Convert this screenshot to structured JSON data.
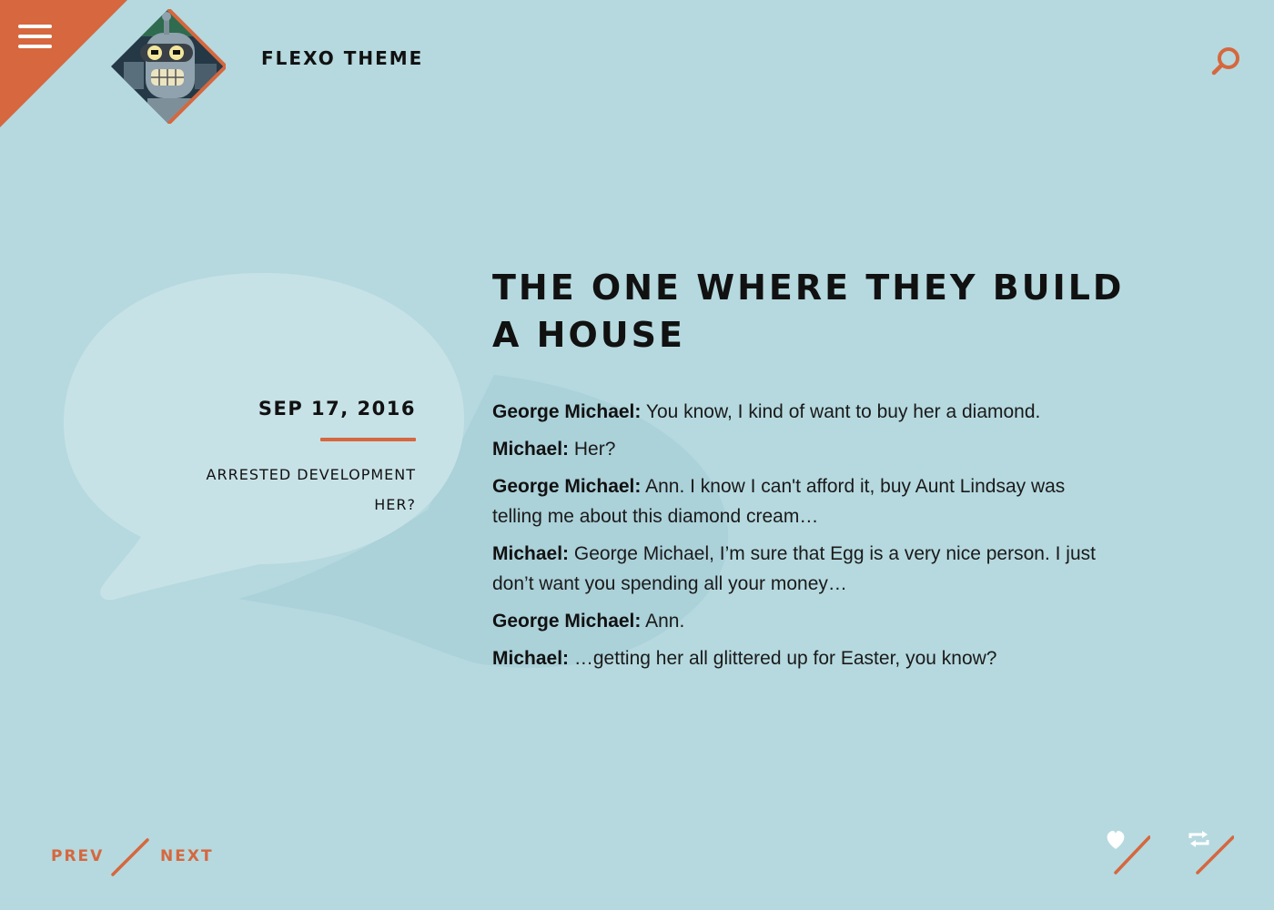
{
  "header": {
    "site_title": "FLEXO THEME",
    "accent_color": "#d6673e",
    "background_color": "#b5d9df",
    "menu_icon": "hamburger-menu-icon",
    "search_icon": "magnifier-search-icon"
  },
  "post": {
    "title": "THE ONE WHERE THEY BUILD A HOUSE",
    "date": "SEP 17, 2016",
    "tags": [
      "ARRESTED DEVELOPMENT",
      "HER?"
    ],
    "type_icon": "chat-bubbles-icon",
    "chat": [
      {
        "speaker": "George Michael:",
        "text": "You know, I kind of want to buy her a diamond."
      },
      {
        "speaker": "Michael:",
        "text": "Her?"
      },
      {
        "speaker": "George Michael:",
        "text": "Ann. I know I can't afford it, buy Aunt Lindsay was telling me about this diamond cream…"
      },
      {
        "speaker": "Michael:",
        "text": "George Michael, I’m sure that Egg is a very nice person. I just don’t want you spending all your money…"
      },
      {
        "speaker": "George Michael:",
        "text": "Ann."
      },
      {
        "speaker": "Michael:",
        "text": "…getting her all glittered up for Easter, you know?"
      }
    ]
  },
  "footer": {
    "prev_label": "PREV",
    "next_label": "NEXT",
    "like_icon": "heart-icon",
    "reblog_icon": "reblog-icon"
  }
}
